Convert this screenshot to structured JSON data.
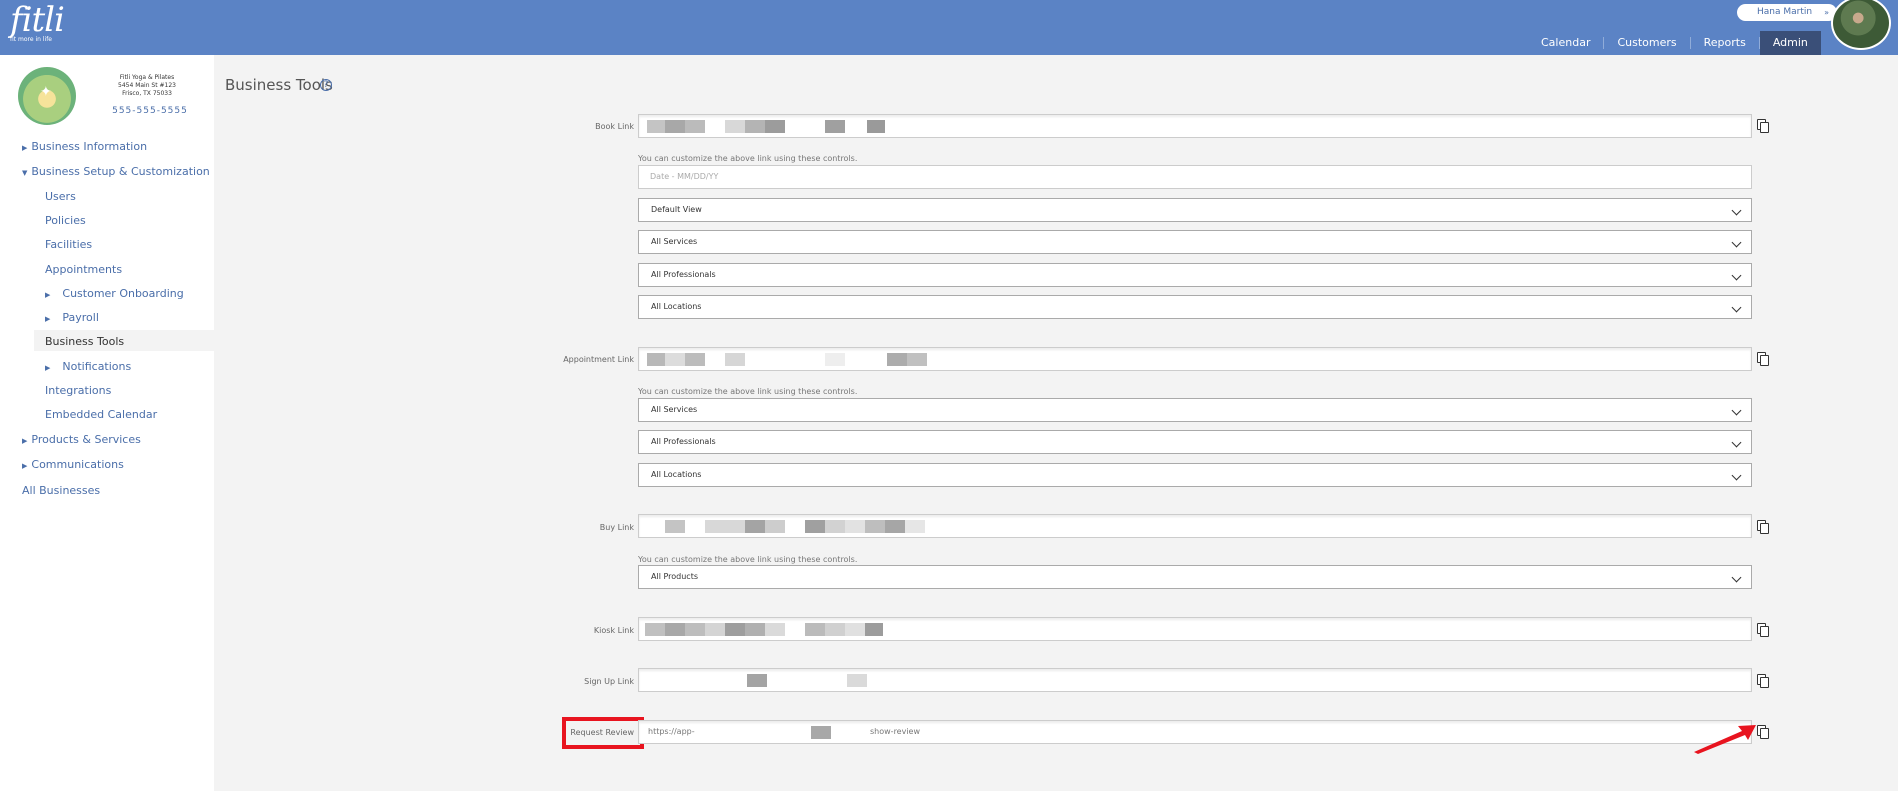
{
  "header": {
    "logo_text": "fitli",
    "logo_tagline": "fit more in life",
    "user_name": "Hana Martin",
    "user_chevron": "»",
    "nav": [
      "Calendar",
      "Customers",
      "Reports",
      "Admin"
    ]
  },
  "business": {
    "name": "Fitli Yoga & Pilates",
    "address1": "5454 Main St #123",
    "address2": "Frisco, TX 75033",
    "phone": "555-555-5555"
  },
  "sidebar": {
    "business_information": "Business Information",
    "business_setup": "Business Setup & Customization",
    "users": "Users",
    "policies": "Policies",
    "facilities": "Facilities",
    "appointments": "Appointments",
    "customer_onboarding": "Customer Onboarding",
    "payroll": "Payroll",
    "business_tools": "Business Tools",
    "notifications": "Notifications",
    "integrations": "Integrations",
    "embedded_calendar": "Embedded Calendar",
    "products_services": "Products & Services",
    "communications": "Communications",
    "all_businesses": "All Businesses"
  },
  "main": {
    "title": "Business Tools",
    "help_icon": "?",
    "hint": "You can customize the above link using these controls.",
    "book": {
      "label": "Book Link",
      "date_placeholder": "Date - MM/DD/YY",
      "view": "Default View",
      "services": "All Services",
      "professionals": "All Professionals",
      "locations": "All Locations"
    },
    "appointment": {
      "label": "Appointment Link",
      "services": "All Services",
      "professionals": "All Professionals",
      "locations": "All Locations"
    },
    "buy": {
      "label": "Buy Link",
      "products": "All Products"
    },
    "kiosk": {
      "label": "Kiosk Link"
    },
    "signup": {
      "label": "Sign Up Link"
    },
    "review": {
      "label": "Request Review",
      "url_start": "https://app-",
      "url_end": "show-review"
    }
  },
  "colors": {
    "header_bg": "#5b83c5",
    "admin_active": "#3a4f78",
    "link": "#4a6ea9",
    "highlight": "#e8141f"
  }
}
